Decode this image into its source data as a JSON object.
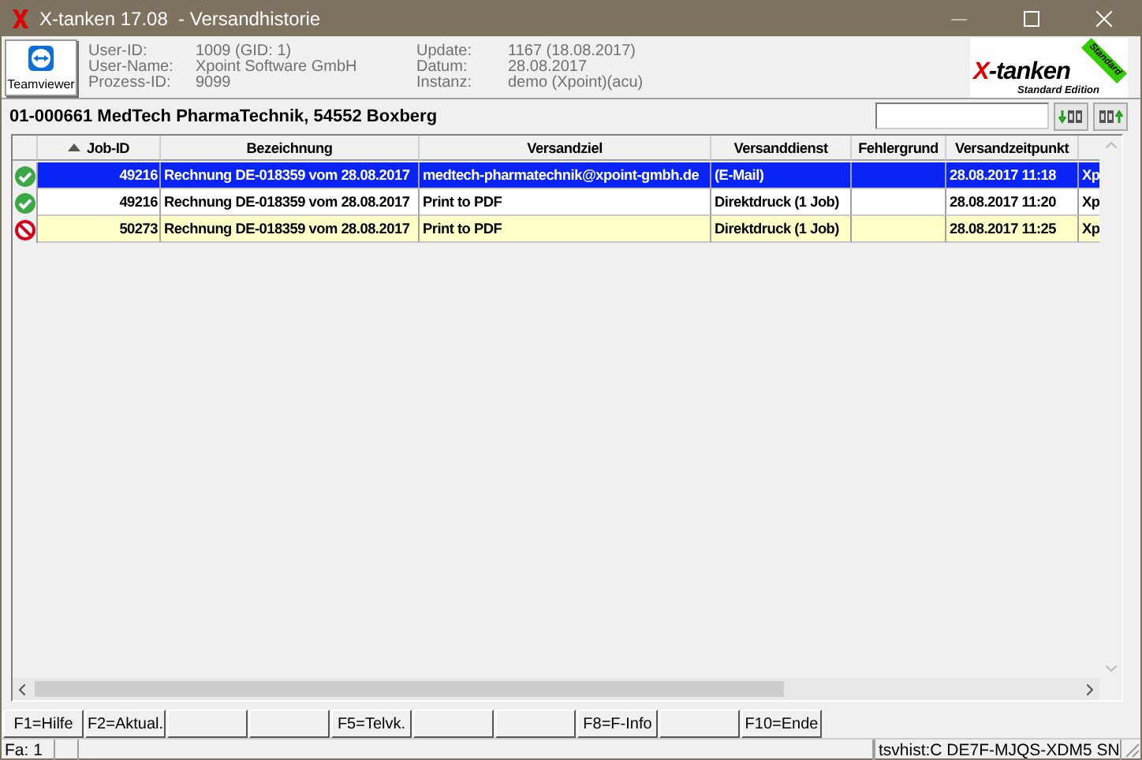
{
  "window": {
    "title": "X-tanken 17.08  - Versandhistorie"
  },
  "header": {
    "teamviewer_label": "Teamviewer",
    "info": [
      {
        "label": "User-ID:",
        "value": "1009 (GID: 1)"
      },
      {
        "label": "User-Name:",
        "value": "Xpoint Software GmbH"
      },
      {
        "label": "Prozess-ID:",
        "value": "9099"
      },
      {
        "label": "Update:",
        "value": "1167 (18.08.2017)"
      },
      {
        "label": "Datum:",
        "value": "28.08.2017"
      },
      {
        "label": "Instanz:",
        "value": "demo (Xpoint)(acu)"
      }
    ],
    "logo": {
      "x": "X",
      "name": "-tanken",
      "edition": "Standard Edition",
      "ribbon": "Standard"
    }
  },
  "customer": "01-000661 MedTech PharmaTechnik, 54552 Boxberg",
  "table": {
    "columns": [
      {
        "label": "Job-ID",
        "sorted": true
      },
      {
        "label": "Bezeichnung",
        "sorted": false
      },
      {
        "label": "Versandziel",
        "sorted": false
      },
      {
        "label": "Versanddienst",
        "sorted": false
      },
      {
        "label": "Fehlergrund",
        "sorted": false
      },
      {
        "label": "Versandzeitpunkt",
        "sorted": false
      }
    ],
    "rows": [
      {
        "failed": false,
        "selected": true,
        "job_id": "49216",
        "bezeichnung": "Rechnung DE-018359 vom 28.08.2017",
        "versandziel": "medtech-pharmatechnik@xpoint-gmbh.de",
        "versanddienst": "(E-Mail)",
        "versandzeitpunkt": "28.08.2017 11:18",
        "column_8": "Xp"
      },
      {
        "failed": false,
        "selected": false,
        "job_id": "49216",
        "bezeichnung": "Rechnung DE-018359 vom 28.08.2017",
        "versandziel": "Print to PDF",
        "versanddienst": "Direktdruck (1 Job)",
        "versandzeitpunkt": "28.08.2017 11:20",
        "column_8": "Xp"
      },
      {
        "failed": true,
        "selected": false,
        "job_id": "50273",
        "bezeichnung": "Rechnung DE-018359 vom 28.08.2017",
        "versandziel": "Print to PDF",
        "versanddienst": "Direktdruck (1 Job)",
        "versandzeitpunkt": "28.08.2017 11:25",
        "column_8": "Xp"
      }
    ]
  },
  "function_keys": [
    {
      "kind": "key",
      "label": "F1=Hilfe"
    },
    {
      "kind": "key",
      "label": "F2=Aktual."
    },
    {
      "kind": "blank"
    },
    {
      "kind": "blank"
    },
    {
      "kind": "key",
      "label": "F5=Telvk."
    },
    {
      "kind": "blank"
    },
    {
      "kind": "blank"
    },
    {
      "kind": "key",
      "label": "F8=F-Info"
    },
    {
      "kind": "blank"
    },
    {
      "kind": "key",
      "label": "F10=Ende"
    }
  ],
  "status_bar": {
    "left": "Fa: 1",
    "right": "tsvhist:C DE7F-MJQS-XDM5 SN"
  }
}
